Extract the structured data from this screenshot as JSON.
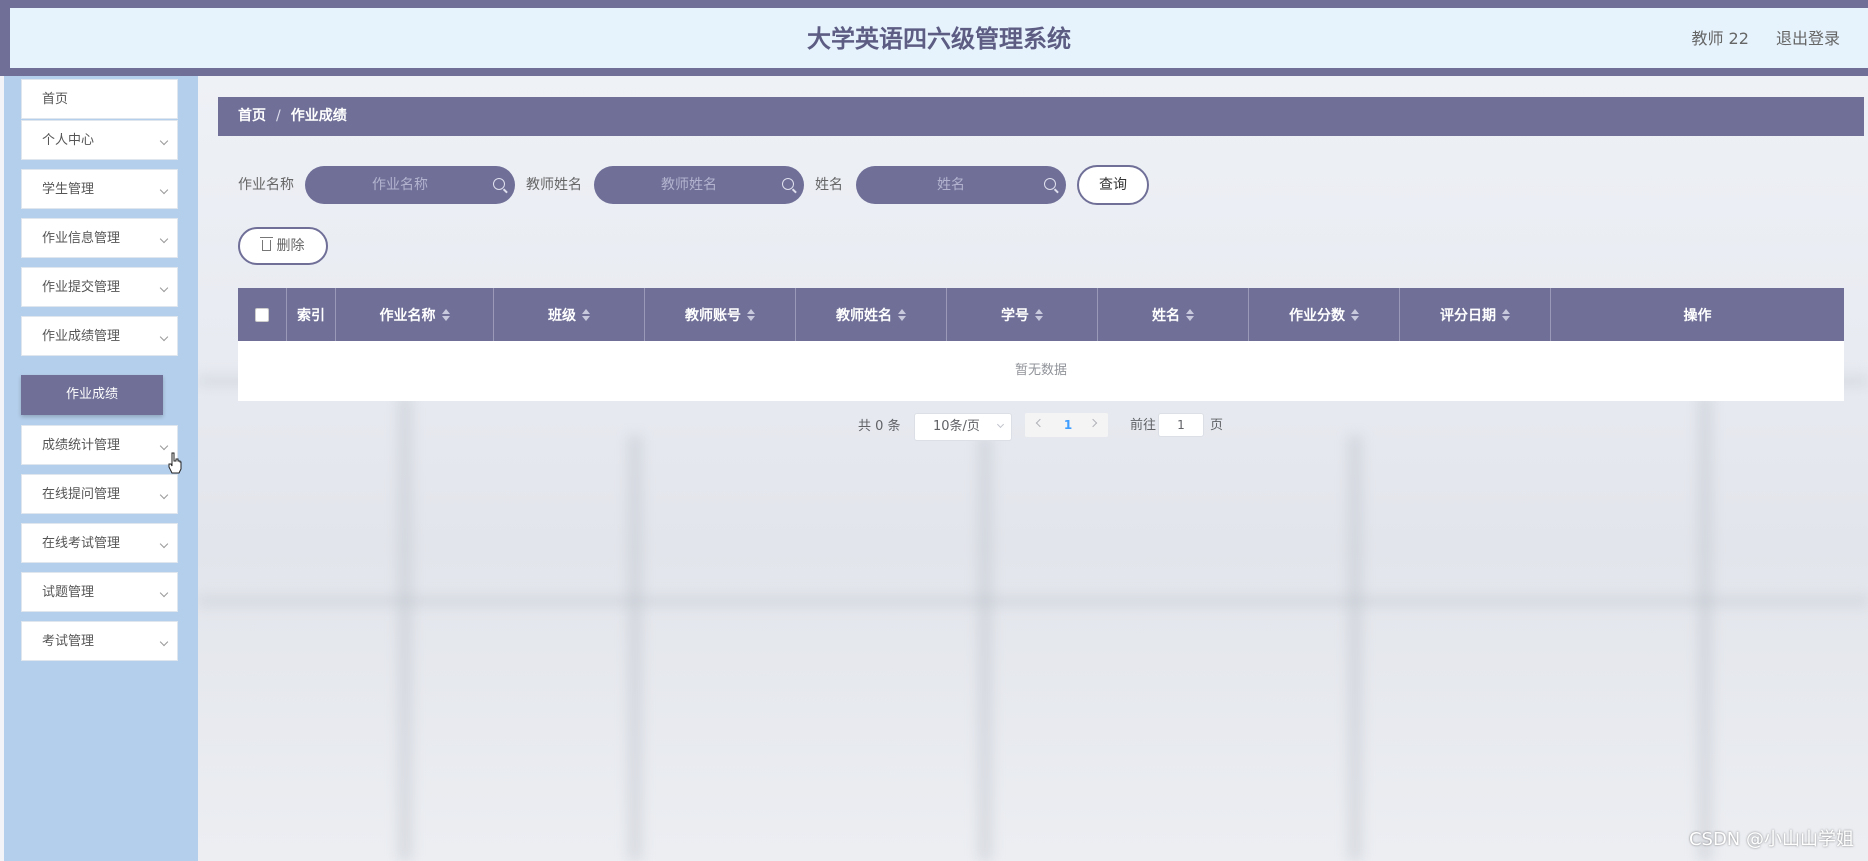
{
  "header": {
    "title": "大学英语四六级管理系统",
    "user": "教师 22",
    "logout": "退出登录"
  },
  "sidebar": {
    "items": [
      {
        "label": "首页"
      },
      {
        "label": "个人中心"
      },
      {
        "label": "学生管理"
      },
      {
        "label": "作业信息管理"
      },
      {
        "label": "作业提交管理"
      },
      {
        "label": "作业成绩管理"
      },
      {
        "label": "成绩统计管理"
      },
      {
        "label": "在线提问管理"
      },
      {
        "label": "在线考试管理"
      },
      {
        "label": "试题管理"
      },
      {
        "label": "考试管理"
      }
    ],
    "active_sub": "作业成绩"
  },
  "breadcrumb": {
    "home": "首页",
    "sep": "/",
    "current": "作业成绩"
  },
  "search": {
    "field1_label": "作业名称",
    "field1_placeholder": "作业名称",
    "field2_label": "教师姓名",
    "field2_placeholder": "教师姓名",
    "field3_label": "姓名",
    "field3_placeholder": "姓名",
    "query_label": "查询"
  },
  "actions": {
    "delete_label": "删除"
  },
  "table": {
    "columns": [
      "索引",
      "作业名称",
      "班级",
      "教师账号",
      "教师姓名",
      "学号",
      "姓名",
      "作业分数",
      "评分日期",
      "操作"
    ],
    "empty_text": "暂无数据"
  },
  "pagination": {
    "total": "共 0 条",
    "page_size": "10条/页",
    "current_page": "1",
    "goto_label": "前往",
    "goto_value": "1",
    "goto_suffix": "页"
  },
  "watermark": "CSDN @小山山学姐",
  "colors": {
    "theme": "#6f6f98",
    "sidebar_bg": "#b4cfec",
    "header_bg": "#e6f3fc"
  }
}
